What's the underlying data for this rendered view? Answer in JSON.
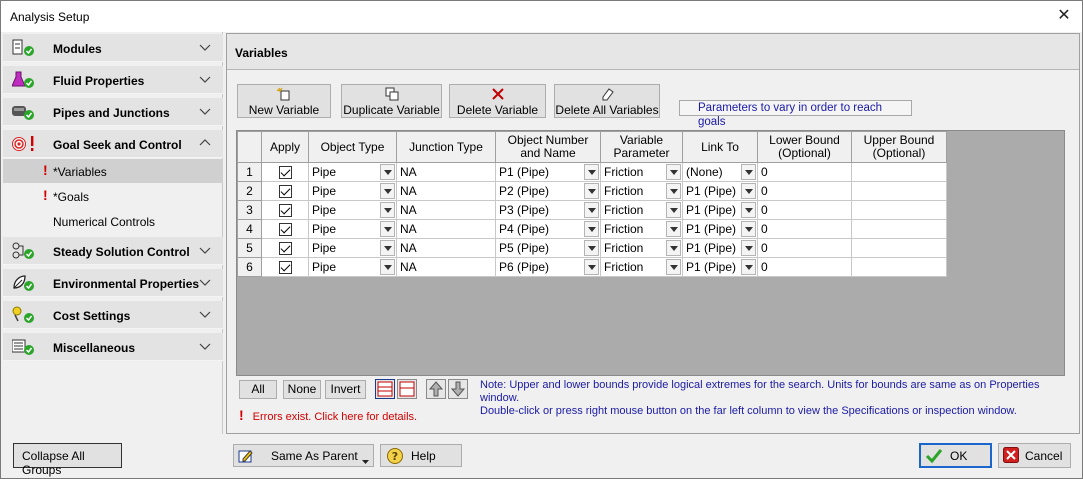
{
  "window": {
    "title": "Analysis Setup",
    "close_glyph": "✕"
  },
  "sidebar": {
    "groups": [
      {
        "label": "Modules",
        "icon": "modules-icon"
      },
      {
        "label": "Fluid Properties",
        "icon": "flask-icon"
      },
      {
        "label": "Pipes and Junctions",
        "icon": "pipe-icon"
      },
      {
        "label": "Goal Seek and Control",
        "icon": "target-icon",
        "expanded": true
      },
      {
        "label": "Steady Solution Control",
        "icon": "solution-icon"
      },
      {
        "label": "Environmental Properties",
        "icon": "environment-icon"
      },
      {
        "label": "Cost Settings",
        "icon": "cost-icon"
      },
      {
        "label": "Miscellaneous",
        "icon": "misc-icon"
      }
    ],
    "goal_seek_items": [
      {
        "label": "*Variables",
        "error": true,
        "selected": true
      },
      {
        "label": "*Goals",
        "error": true,
        "selected": false
      },
      {
        "label": "Numerical Controls",
        "error": false,
        "selected": false
      }
    ]
  },
  "panel": {
    "title": "Variables",
    "toolbar": {
      "new_variable": "New Variable",
      "duplicate_variable": "Duplicate Variable",
      "delete_variable": "Delete Variable",
      "delete_all_variables": "Delete All Variables"
    },
    "hint": "Parameters to vary in order to reach goals",
    "table": {
      "columns": {
        "apply": "Apply",
        "object_type": "Object Type",
        "junction_type": "Junction Type",
        "object_number_1": "Object Number",
        "object_number_2": "and Name",
        "variable_parameter_1": "Variable",
        "variable_parameter_2": "Parameter",
        "link_to": "Link To",
        "lower_bound_1": "Lower Bound",
        "lower_bound_2": "(Optional)",
        "upper_bound_1": "Upper Bound",
        "upper_bound_2": "(Optional)"
      },
      "rows": [
        {
          "num": "1",
          "applied": true,
          "object_type": "Pipe",
          "junction_type": "NA",
          "object": "P1 (Pipe)",
          "parameter": "Friction",
          "link_to": "(None)",
          "lower": "0",
          "upper": ""
        },
        {
          "num": "2",
          "applied": true,
          "object_type": "Pipe",
          "junction_type": "NA",
          "object": "P2 (Pipe)",
          "parameter": "Friction",
          "link_to": "P1 (Pipe)",
          "lower": "0",
          "upper": ""
        },
        {
          "num": "3",
          "applied": true,
          "object_type": "Pipe",
          "junction_type": "NA",
          "object": "P3 (Pipe)",
          "parameter": "Friction",
          "link_to": "P1 (Pipe)",
          "lower": "0",
          "upper": ""
        },
        {
          "num": "4",
          "applied": true,
          "object_type": "Pipe",
          "junction_type": "NA",
          "object": "P4 (Pipe)",
          "parameter": "Friction",
          "link_to": "P1 (Pipe)",
          "lower": "0",
          "upper": ""
        },
        {
          "num": "5",
          "applied": true,
          "object_type": "Pipe",
          "junction_type": "NA",
          "object": "P5 (Pipe)",
          "parameter": "Friction",
          "link_to": "P1 (Pipe)",
          "lower": "0",
          "upper": ""
        },
        {
          "num": "6",
          "applied": true,
          "object_type": "Pipe",
          "junction_type": "NA",
          "object": "P6 (Pipe)",
          "parameter": "Friction",
          "link_to": "P1 (Pipe)",
          "lower": "0",
          "upper": ""
        }
      ]
    },
    "select_buttons": {
      "all": "All",
      "none": "None",
      "invert": "Invert"
    },
    "note_line1": "Note: Upper and lower bounds provide logical extremes for the search. Units for bounds are same as on Properties window.",
    "note_line2": "Double-click or press right mouse button on the far left column to view the Specifications or inspection window.",
    "error_text": "Errors exist. Click here for details."
  },
  "footer": {
    "collapse_all": "Collapse All Groups",
    "same_as_parent": "Same As Parent",
    "help": "Help",
    "ok": "OK",
    "cancel": "Cancel"
  },
  "colors": {
    "error_red": "#d40000",
    "ok_green": "#2aa52a",
    "note_blue": "#1a1aa6"
  }
}
